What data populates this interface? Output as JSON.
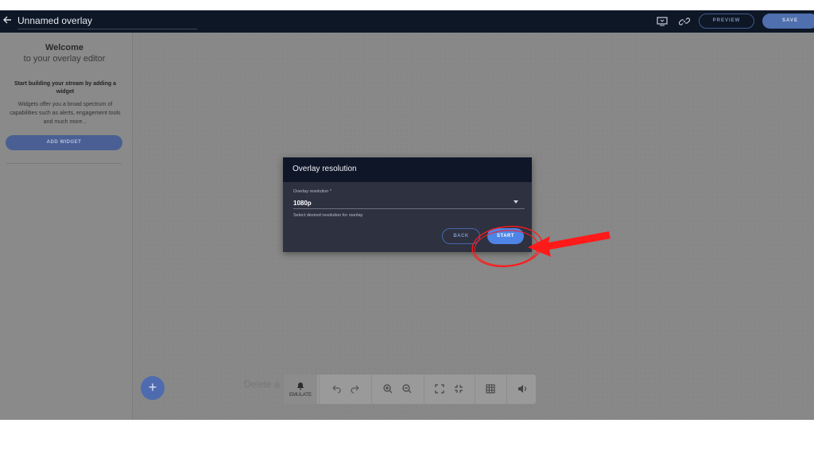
{
  "header": {
    "title": "Unnamed overlay",
    "preview_label": "PREVIEW",
    "save_label": "SAVE",
    "icons": [
      "back-arrow-icon",
      "emulate-screen-icon",
      "link-icon"
    ]
  },
  "sidebar": {
    "welcome_title": "Welcome",
    "welcome_subtitle": "to your overlay editor",
    "start_heading": "Start building your stream by adding a widget",
    "description": "Widgets offer you a broad spectrum of capabilities such as alerts, engagement tools and much more...",
    "add_widget_label": "ADD WIDGET"
  },
  "canvas": {
    "ghost_text": "Delete a"
  },
  "toolbar": {
    "emulate_label": "EMULATE",
    "tools": [
      "bell-icon",
      "undo-icon",
      "redo-icon",
      "zoom-in-icon",
      "zoom-out-icon",
      "fullscreen-icon",
      "exit-fullscreen-icon",
      "grid-icon",
      "volume-icon"
    ]
  },
  "modal": {
    "title": "Overlay resolution",
    "field_label": "Overlay resolution *",
    "selected_value": "1080p",
    "helper_text": "Select desired resolution for overlay",
    "back_label": "BACK",
    "start_label": "START"
  },
  "colors": {
    "topbar": "#0e1726",
    "accent": "#4d84e6",
    "annotation": "#ff1a1a"
  }
}
